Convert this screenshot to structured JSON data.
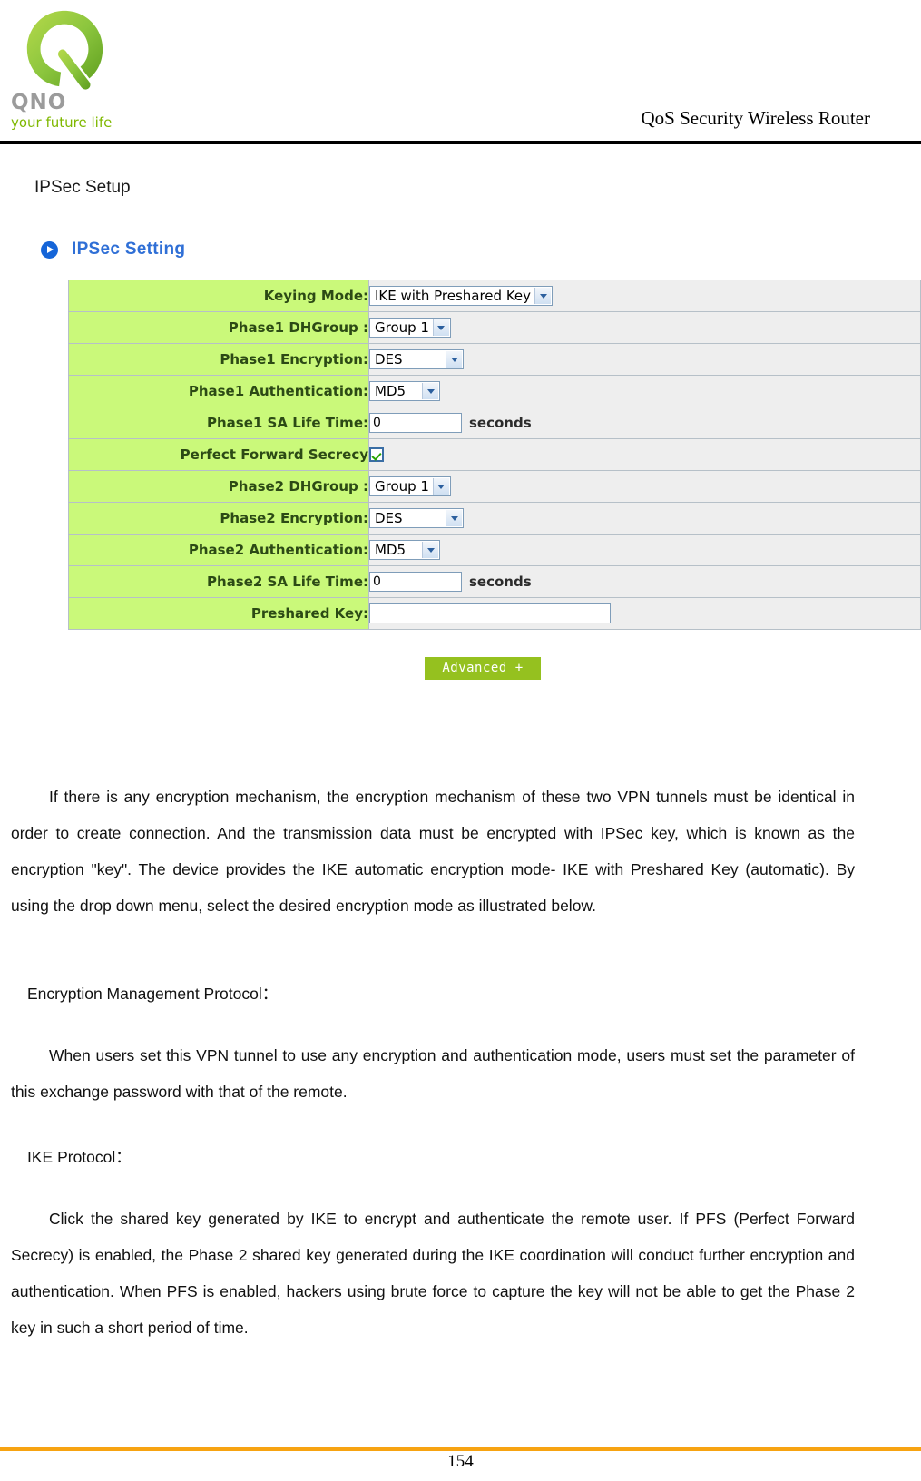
{
  "header": {
    "logo_wordmark": "QNO",
    "logo_tagline": "your future life",
    "title": "QoS Security Wireless Router"
  },
  "section": {
    "title": "IPSec Setup"
  },
  "panel": {
    "icon": "blue-arrow-bullet-icon",
    "title": "IPSec Setting",
    "rows": [
      {
        "label": "Keying Mode:",
        "control": "select",
        "value": "IKE with Preshared Key",
        "unit": ""
      },
      {
        "label": "Phase1 DHGroup :",
        "control": "select",
        "value": "Group 1",
        "unit": ""
      },
      {
        "label": "Phase1 Encryption:",
        "control": "select",
        "value": "DES",
        "unit": ""
      },
      {
        "label": "Phase1 Authentication:",
        "control": "select",
        "value": "MD5",
        "unit": ""
      },
      {
        "label": "Phase1 SA Life Time:",
        "control": "text",
        "value": "0",
        "unit": "seconds"
      },
      {
        "label": "Perfect Forward Secrecy",
        "control": "checkbox",
        "value": "checked",
        "unit": ""
      },
      {
        "label": "Phase2 DHGroup :",
        "control": "select",
        "value": "Group 1",
        "unit": ""
      },
      {
        "label": "Phase2 Encryption:",
        "control": "select",
        "value": "DES",
        "unit": ""
      },
      {
        "label": "Phase2 Authentication:",
        "control": "select",
        "value": "MD5",
        "unit": ""
      },
      {
        "label": "Phase2 SA Life Time:",
        "control": "text",
        "value": "0",
        "unit": "seconds"
      },
      {
        "label": "Preshared Key:",
        "control": "text",
        "value": "",
        "unit": ""
      }
    ],
    "advanced_button": "Advanced +"
  },
  "body": {
    "intro": "If there is any encryption mechanism, the encryption mechanism of these two VPN tunnels must be identical in order to create connection. And the transmission data must be encrypted with IPSec key, which is known as the encryption \"key\". The device provides the IKE automatic encryption mode- IKE with Preshared Key (automatic). By using the drop down menu, select the desired encryption mode as illustrated below.",
    "encryption_heading": "Encryption Management Protocol：",
    "encryption_text": "When users set this VPN tunnel to use any encryption and authentication mode, users must set the parameter of this exchange password with that of the remote.",
    "ike_heading": "IKE Protocol：",
    "ike_text": "Click the shared key generated by IKE to encrypt and authenticate the remote user. If PFS (Perfect Forward Secrecy) is enabled, the Phase 2 shared key generated during the IKE coordination will conduct further encryption and authentication. When PFS is enabled, hackers using brute force to capture the key will not be able to get the Phase 2 key in such a short period of time."
  },
  "footer": {
    "page_number": "154"
  },
  "colors": {
    "label_cell_green": "#caf97a",
    "value_cell_gray": "#eeeeee",
    "panel_title_blue": "#2f6fd6",
    "advanced_button_green": "#95c11f",
    "footer_rule_orange": "#f7a311",
    "logo_green": "#7fb800"
  }
}
